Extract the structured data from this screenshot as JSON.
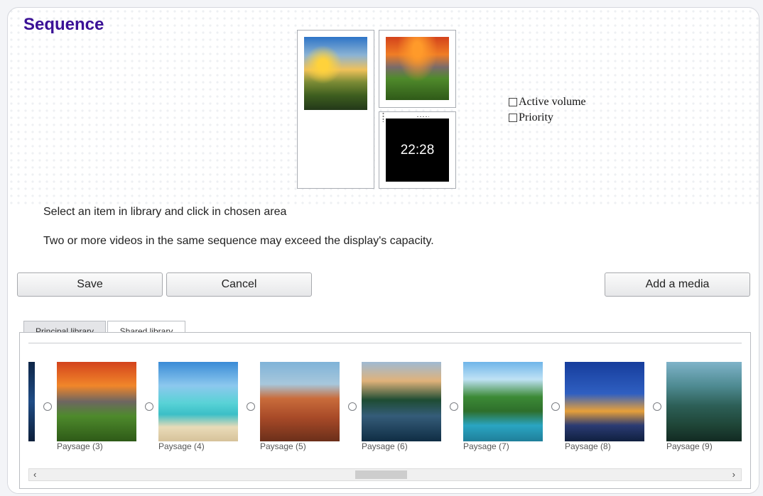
{
  "page": {
    "title": "Sequence"
  },
  "layout_zones": {
    "left_zone": {
      "image": "landscape-valley"
    },
    "top_right_zone": {
      "image": "landscape-sunset-rock"
    },
    "bottom_right_zone": {
      "clock": "22:28"
    }
  },
  "options": {
    "active_volume": {
      "label": "Active volume",
      "checked": false
    },
    "priority": {
      "label": "Priority",
      "checked": false
    }
  },
  "instructions": {
    "line1": "Select an item in library and click in chosen area",
    "line2": "Two or more videos in the same sequence may exceed the display's capacity."
  },
  "buttons": {
    "save": "Save",
    "cancel": "Cancel",
    "add_media": "Add a media"
  },
  "tabs": [
    {
      "label": "Principal library",
      "active": false
    },
    {
      "label": "Shared library",
      "active": true
    }
  ],
  "library": {
    "items": [
      {
        "label": "Paysage (3)",
        "selected": false
      },
      {
        "label": "Paysage (4)",
        "selected": false
      },
      {
        "label": "Paysage (5)",
        "selected": false
      },
      {
        "label": "Paysage (6)",
        "selected": false
      },
      {
        "label": "Paysage (7)",
        "selected": false
      },
      {
        "label": "Paysage (8)",
        "selected": false
      },
      {
        "label": "Paysage (9)",
        "selected": false
      }
    ],
    "scroll_left": "‹",
    "scroll_right": "›"
  },
  "colors": {
    "title": "#3b1196",
    "clock_bg": "#000000",
    "clock_text": "#ffffff"
  }
}
